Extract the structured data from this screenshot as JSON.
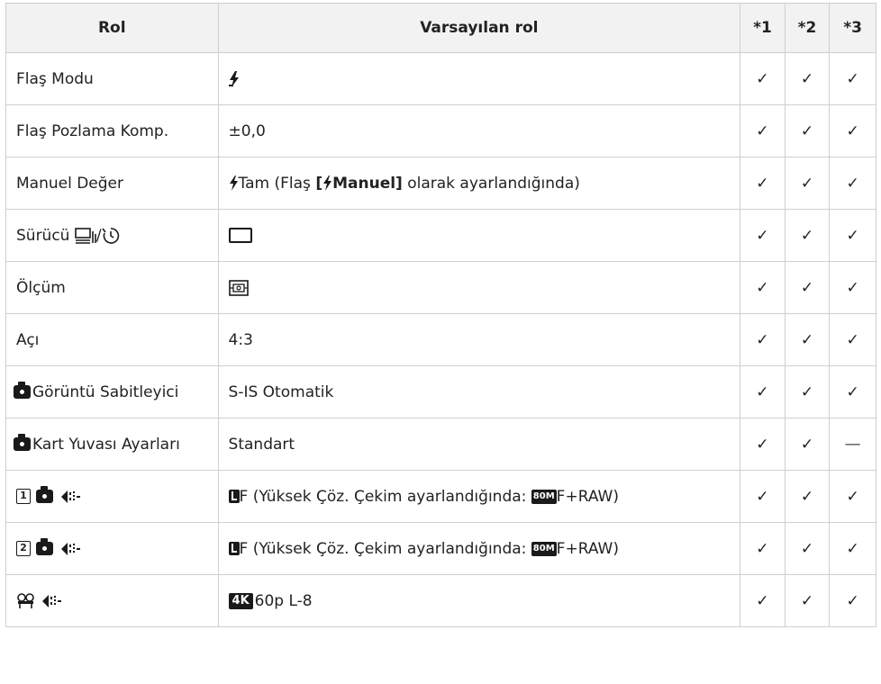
{
  "table": {
    "headers": {
      "role": "Rol",
      "default": "Varsayılan rol",
      "m1": "*1",
      "m2": "*2",
      "m3": "*3"
    },
    "rows": [
      {
        "role": "Flaş Modu",
        "default": "",
        "marks": [
          "✓",
          "✓",
          "✓"
        ]
      },
      {
        "role": "Flaş Pozlama Komp.",
        "default": "±0,0",
        "marks": [
          "✓",
          "✓",
          "✓"
        ]
      },
      {
        "role": "Manuel Değer",
        "default_prefix": "Tam (Flaş ",
        "default_bold": "[",
        "default_bold2": "Manuel]",
        "default_suffix": " olarak ayarlandığında)",
        "marks": [
          "✓",
          "✓",
          "✓"
        ]
      },
      {
        "role": "Sürücü ",
        "role_sep": "/",
        "default": "",
        "marks": [
          "✓",
          "✓",
          "✓"
        ]
      },
      {
        "role": "Ölçüm",
        "default": "",
        "marks": [
          "✓",
          "✓",
          "✓"
        ]
      },
      {
        "role": "Açı",
        "default": "4:3",
        "marks": [
          "✓",
          "✓",
          "✓"
        ]
      },
      {
        "role": "Görüntü Sabitleyici",
        "default": "S-IS Otomatik",
        "marks": [
          "✓",
          "✓",
          "✓"
        ]
      },
      {
        "role": "Kart Yuvası Ayarları",
        "default": "Standart",
        "marks": [
          "✓",
          "✓",
          "—"
        ]
      },
      {
        "role": "",
        "slot": "1",
        "default": "F (Yüksek Çöz. Çekim ayarlandığında: ",
        "default_badge": "80M",
        "default_suffix": "F+RAW)",
        "marks": [
          "✓",
          "✓",
          "✓"
        ]
      },
      {
        "role": "",
        "slot": "2",
        "default": "F (Yüksek Çöz. Çekim ayarlandığında: ",
        "default_badge": "80M",
        "default_suffix": "F+RAW)",
        "marks": [
          "✓",
          "✓",
          "✓"
        ]
      },
      {
        "role": "",
        "default_badge": "4K",
        "default": "60p L-8",
        "marks": [
          "✓",
          "✓",
          "✓"
        ]
      }
    ]
  },
  "icons": {
    "flash": "flash-icon",
    "sequential": "sequential-shooting-icon",
    "self_timer": "self-timer-icon",
    "single_frame": "single-frame-icon",
    "metering": "digital-esp-metering-icon",
    "camera": "camera-icon",
    "image_quality": "image-quality-icon",
    "movie": "movie-icon",
    "large_size": "large-size-icon"
  }
}
